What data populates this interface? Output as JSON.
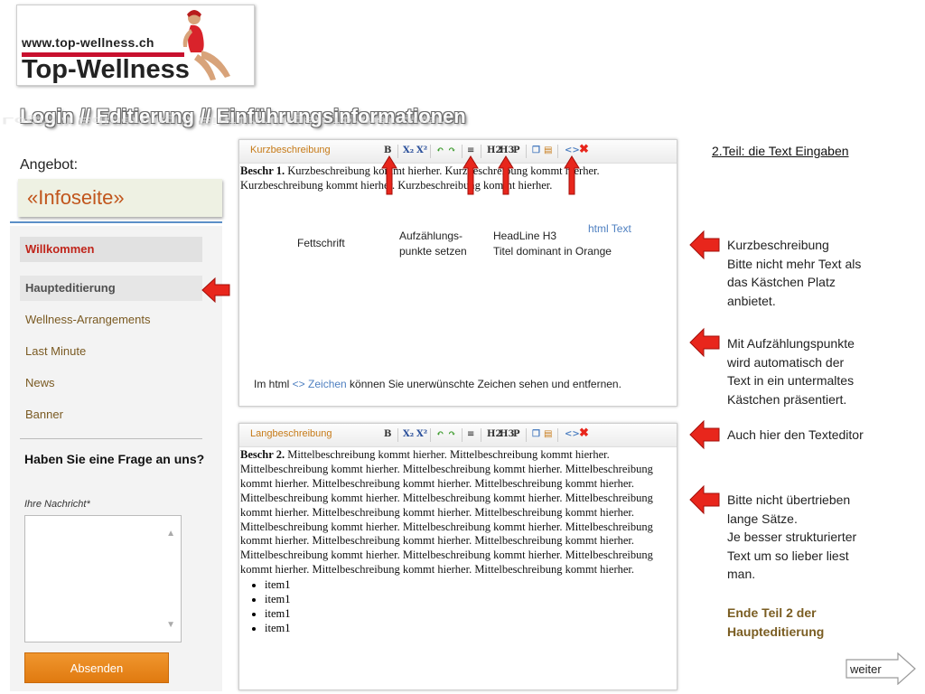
{
  "logo": {
    "url": "www.top-wellness.ch",
    "name": "Top-Wellness"
  },
  "heading": "Login  // Editierung  // Einführungsinformationen",
  "angebot_label": "Angebot:",
  "infoseite": "«Infoseite»",
  "nav": [
    {
      "label": "Willkommen"
    },
    {
      "label": "Haupteditierung"
    },
    {
      "label": "Wellness-Arrangements"
    },
    {
      "label": "Last Minute"
    },
    {
      "label": "News"
    },
    {
      "label": "Banner"
    }
  ],
  "contact": {
    "question": "Haben Sie eine Frage an uns?",
    "message_label": "Ihre Nachricht*",
    "submit": "Absenden"
  },
  "editor1": {
    "label": "Kurzbeschreibung",
    "bold_lead": "Beschr 1.",
    "text": " Kurzbeschreibung kommt hierher. Kurzbeschreibung kommt hierher. Kurzbeschreibung kommt hierher. Kurzbeschreibung kommt hierher."
  },
  "editor2": {
    "label": "Langbeschreibung",
    "bold_lead": "Beschr 2.",
    "text": " Mittelbeschreibung kommt hierher. Mittelbeschreibung kommt hierher. Mittelbeschreibung kommt hierher. Mittelbeschreibung kommt hierher. Mittelbeschreibung kommt hierher. Mittelbeschreibung kommt hierher. Mittelbeschreibung kommt hierher. Mittelbeschreibung kommt hierher. Mittelbeschreibung kommt hierher. Mittelbeschreibung kommt hierher. Mittelbeschreibung kommt hierher. Mittelbeschreibung kommt hierher. Mittelbeschreibung kommt hierher. Mittelbeschreibung kommt hierher. Mittelbeschreibung kommt hierher. Mittelbeschreibung kommt hierher. Mittelbeschreibung kommt hierher. Mittelbeschreibung kommt hierher. Mittelbeschreibung kommt hierher. Mittelbeschreibung kommt hierher. Mittelbeschreibung kommt hierher. Mittelbeschreibung kommt hierher.",
    "items": [
      "item1",
      "item1",
      "item1",
      "item1"
    ]
  },
  "toolbar": {
    "bold": "B",
    "sub": "X₂",
    "sup": "X²",
    "h2": "H2",
    "h3": "H3",
    "p": "P"
  },
  "annotations": {
    "fettschrift": "Fettschrift",
    "aufzaehlung_line1": "Aufzählungs-",
    "aufzaehlung_line2": "punkte setzen",
    "headline_line1": "HeadLine  H3",
    "headline_line2": "Titel dominant in Orange",
    "html_text": "html Text",
    "html_note_pre": "Im html ",
    "html_note_sym": "<> Zeichen",
    "html_note_post": " können Sie unerwünschte Zeichen sehen und entfernen."
  },
  "right": {
    "teil": "2.Teil:  die Text Eingaben",
    "kurz_1": "Kurzbeschreibung",
    "kurz_2": "Bitte nicht mehr Text als",
    "kurz_3": "das Kästchen Platz",
    "kurz_4": "anbietet.",
    "aufz_1": "Mit Aufzählungspunkte",
    "aufz_2": "wird automatisch der",
    "aufz_3": "Text in ein untermaltes",
    "aufz_4": "Kästchen präsentiert.",
    "auch": "Auch hier den Texteditor",
    "bitte_1": "Bitte nicht übertrieben",
    "bitte_2": "lange Sätze.",
    "bitte_3": "Je besser strukturierter",
    "bitte_4": "Text um so lieber liest",
    "bitte_5": "man.",
    "ende_1": "Ende Teil 2 der",
    "ende_2": "Haupteditierung"
  },
  "weiter": "weiter",
  "colors": {
    "accent_red": "#e8261c",
    "orange": "#c67a17",
    "blue": "#4f80c1"
  }
}
